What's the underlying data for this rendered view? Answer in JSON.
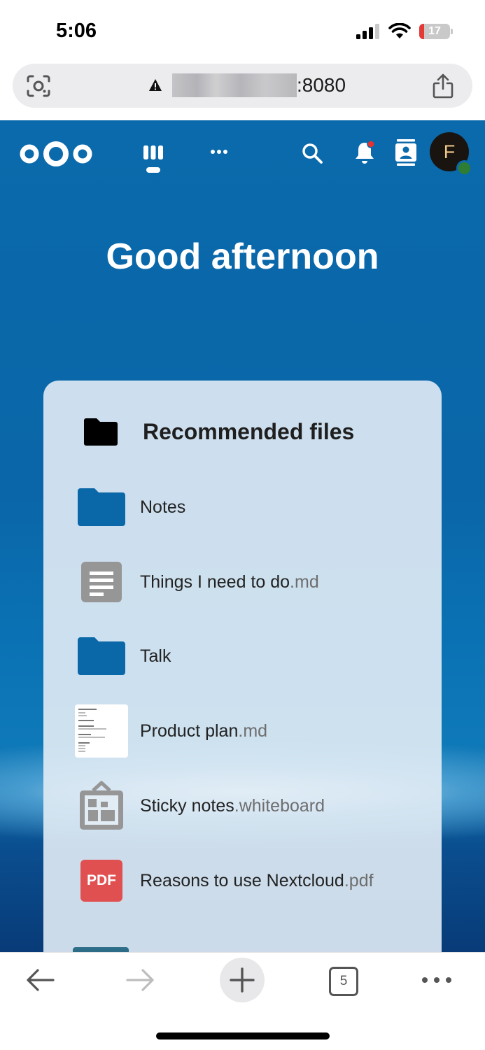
{
  "status_bar": {
    "time": "5:06",
    "battery": "17"
  },
  "browser": {
    "url_suffix": ":8080",
    "tab_count": "5"
  },
  "nextcloud": {
    "greeting": "Good afternoon",
    "avatar_initial": "F",
    "recommended": {
      "title": "Recommended files",
      "files": [
        {
          "name": "Notes",
          "ext": "",
          "type": "folder"
        },
        {
          "name": "Things I need to do",
          "ext": ".md",
          "type": "text"
        },
        {
          "name": "Talk",
          "ext": "",
          "type": "folder"
        },
        {
          "name": "Product plan",
          "ext": ".md",
          "type": "doc-preview"
        },
        {
          "name": "Sticky notes",
          "ext": ".whiteboard",
          "type": "whiteboard"
        },
        {
          "name": "Reasons to use Nextcloud",
          "ext": ".pdf",
          "type": "pdf",
          "badge": "PDF"
        }
      ]
    }
  },
  "colors": {
    "brand_blue": "#0a6aab",
    "folder_blue": "#0a68a8",
    "pdf_red": "#e15050",
    "status_online": "#2e7d32"
  }
}
